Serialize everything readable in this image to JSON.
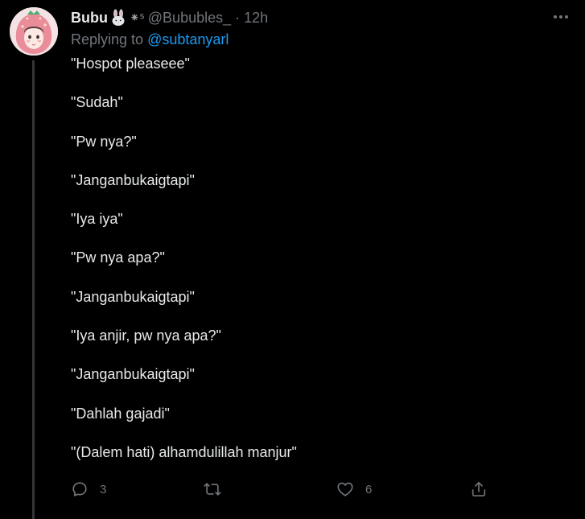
{
  "tweet": {
    "display_name": "Bubu",
    "badge_emoji": "rabbit-emoji",
    "sparkle_text": "⁕⁵",
    "handle": "@Bububles_",
    "separator": "·",
    "time": "12h",
    "replying_prefix": "Replying to ",
    "replying_to": "@subtanyarl",
    "lines": [
      "\"Hospot pleaseee\"",
      "\"Sudah\"",
      "\"Pw nya?\"",
      "\"Janganbukaigtapi\"",
      "\"Iya iya\"",
      "\"Pw nya apa?\"",
      "\"Janganbukaigtapi\"",
      "\"Iya anjir, pw nya apa?\"",
      "\"Janganbukaigtapi\"",
      "\"Dahlah gajadi\"",
      "\"(Dalem hati) alhamdulillah manjur\""
    ],
    "actions": {
      "reply_count": "3",
      "retweet_count": "",
      "like_count": "6"
    }
  },
  "colors": {
    "background": "#000000",
    "text": "#e7e9ea",
    "muted": "#71767b",
    "link": "#1d9bf0"
  }
}
